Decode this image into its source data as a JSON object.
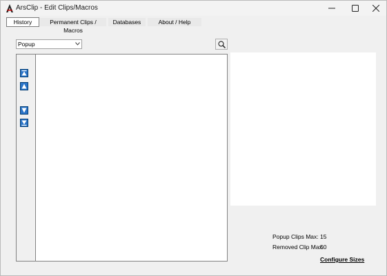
{
  "window": {
    "title": "ArsClip - Edit Clips/Macros"
  },
  "tabs": [
    {
      "label": "History",
      "active": true
    },
    {
      "label": "Permanent Clips / Macros",
      "active": false
    },
    {
      "label": "Databases",
      "active": false
    },
    {
      "label": "About / Help",
      "active": false
    }
  ],
  "filter": {
    "selected": "Popup"
  },
  "side_buttons": [
    {
      "icon": "move-to-top-icon"
    },
    {
      "icon": "move-up-icon"
    },
    {
      "icon": "move-down-icon"
    },
    {
      "icon": "move-to-bottom-icon"
    }
  ],
  "info": {
    "popup_label": "Popup Clips Max:",
    "popup_value": "15",
    "removed_label": "Removed Clip Max:",
    "removed_value": "50"
  },
  "configure_link": "Configure Sizes",
  "colors": {
    "window_bg": "#f0f0f0",
    "arrow_button": "#2b74c7",
    "panel_bg": "#ffffff"
  }
}
